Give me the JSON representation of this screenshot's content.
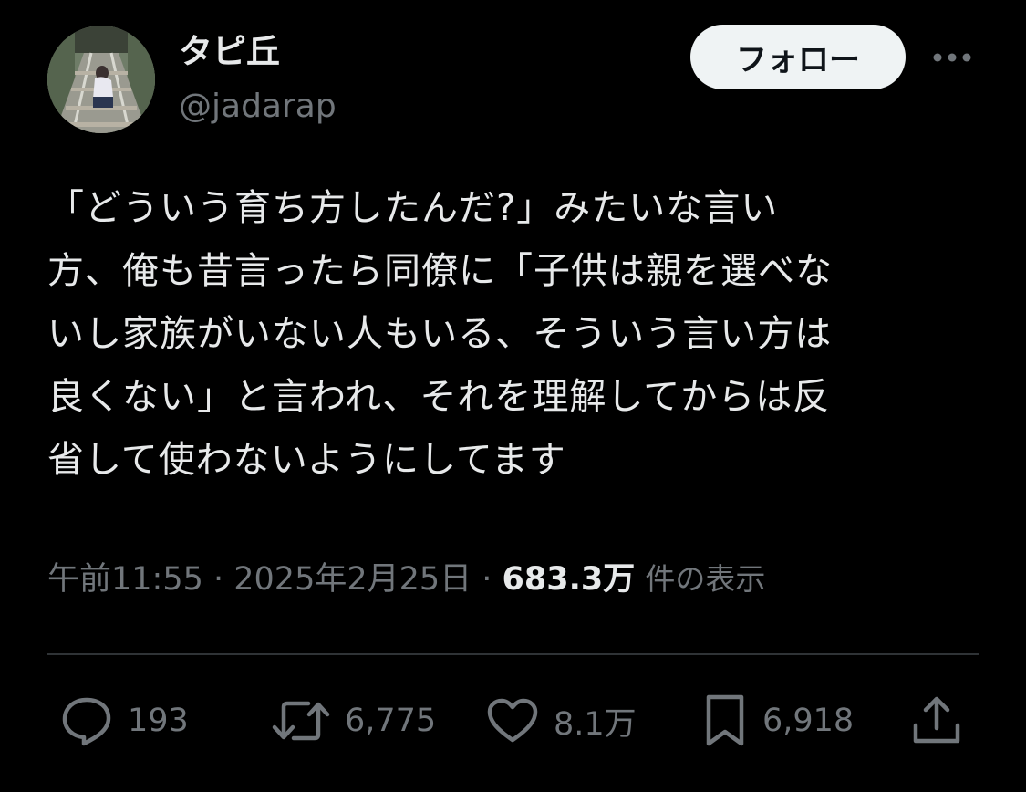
{
  "author": {
    "display_name": "タピ丘",
    "handle": "@jadarap",
    "avatar_icon": "railroad-photo-avatar"
  },
  "follow_button": {
    "label": "フォロー"
  },
  "more_icon": "more-horizontal-icon",
  "tweet": {
    "lines": [
      "「どういう育ち方したんだ?」みたいな言い",
      "方、俺も昔言ったら同僚に「子供は親を選べな",
      "いし家族がいない人もいる、そういう言い方は",
      "良くない」と言われ、それを理解してからは反",
      "省して使わないようにしてます"
    ]
  },
  "meta": {
    "time": "午前11:55",
    "separator": " · ",
    "date": "2025年2月25日",
    "views_count": "683.3万",
    "views_label": "件の表示"
  },
  "actions": {
    "reply": {
      "icon": "reply-icon",
      "count": "193"
    },
    "retweet": {
      "icon": "retweet-icon",
      "count": "6,775"
    },
    "like": {
      "icon": "heart-icon",
      "count": "8.1万"
    },
    "bookmark": {
      "icon": "bookmark-icon",
      "count": "6,918"
    },
    "share": {
      "icon": "share-icon"
    }
  },
  "colors": {
    "background": "#000000",
    "primary_text": "#e7e9ea",
    "secondary_text": "#71767b",
    "follow_button_bg": "#eff3f4",
    "divider": "#2f3336"
  }
}
